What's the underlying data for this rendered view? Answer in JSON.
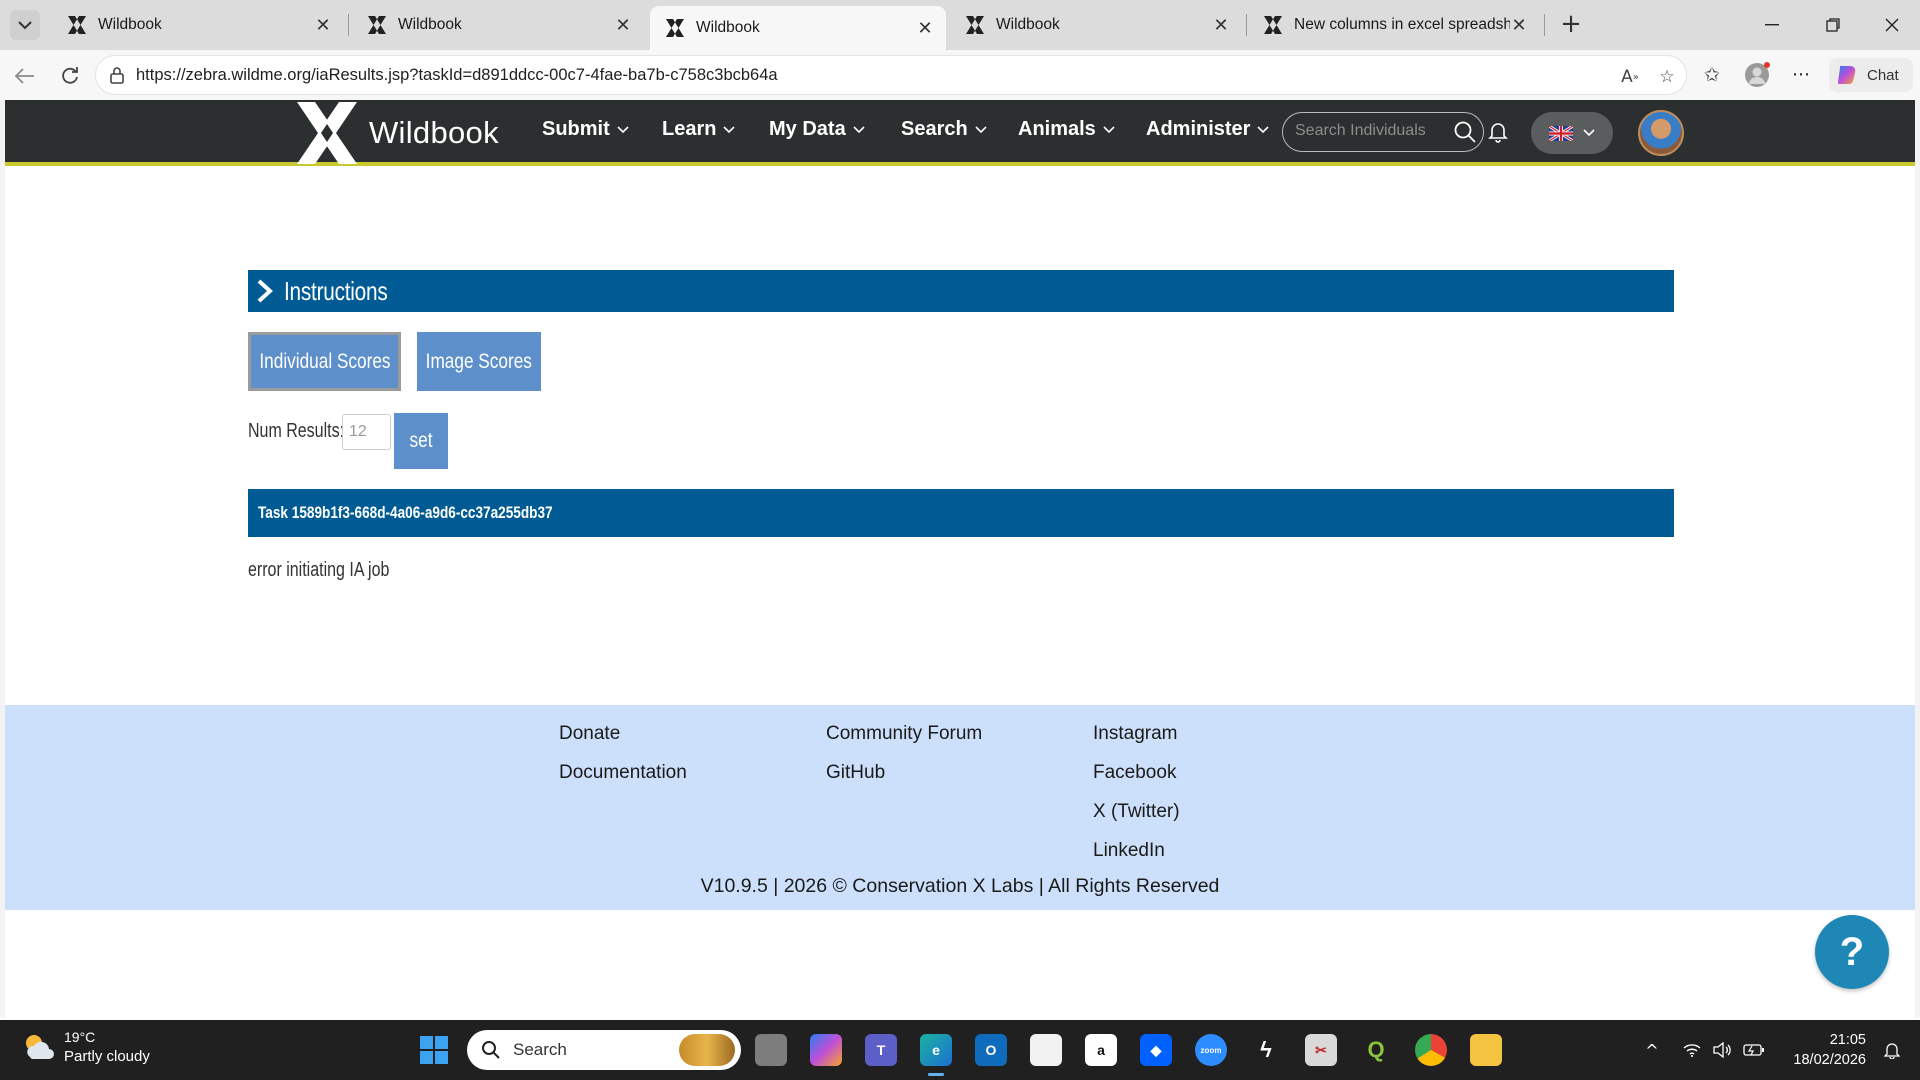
{
  "browser": {
    "tabs": [
      {
        "title": "Wildbook",
        "active": false
      },
      {
        "title": "Wildbook",
        "active": false
      },
      {
        "title": "Wildbook",
        "active": true
      },
      {
        "title": "Wildbook",
        "active": false
      },
      {
        "title": "New columns in excel spreadsheet",
        "active": false
      }
    ],
    "url": "https://zebra.wildme.org/iaResults.jsp?taskId=d891ddcc-00c7-4fae-ba7b-c758c3bcb64a",
    "chat_label": "Chat"
  },
  "site": {
    "brand": "Wildbook",
    "nav": [
      {
        "label": "Submit"
      },
      {
        "label": "Learn"
      },
      {
        "label": "My Data"
      },
      {
        "label": "Search"
      },
      {
        "label": "Animals"
      },
      {
        "label": "Administer"
      }
    ],
    "search_placeholder": "Search Individuals",
    "colors": {
      "header": "#2c2f30",
      "accent_line": "#c9c82f",
      "bar": "#005b94",
      "button": "#5d8fcb",
      "footer": "#cde0fb",
      "help": "#1f87b5"
    }
  },
  "content": {
    "instructions_label": "Instructions",
    "individual_scores_label": "Individual Scores",
    "image_scores_label": "Image Scores",
    "num_results_label": "Num Results:",
    "num_results_value": "12",
    "set_label": "set",
    "task_label": "Task 1589b1f3-668d-4a06-a9d6-cc37a255db37",
    "error_text": "error initiating IA job"
  },
  "footer": {
    "col1": [
      "Donate",
      "Documentation"
    ],
    "col2": [
      "Community Forum",
      "GitHub"
    ],
    "col3": [
      "Instagram",
      "Facebook",
      "X (Twitter)",
      "LinkedIn"
    ],
    "copyright": "V10.9.5 | 2026 © Conservation X Labs | All Rights Reserved",
    "help_label": "?"
  },
  "taskbar": {
    "weather_temp": "19°C",
    "weather_cond": "Partly cloudy",
    "search_label": "Search",
    "time": "21:05",
    "date": "18/02/2026"
  }
}
